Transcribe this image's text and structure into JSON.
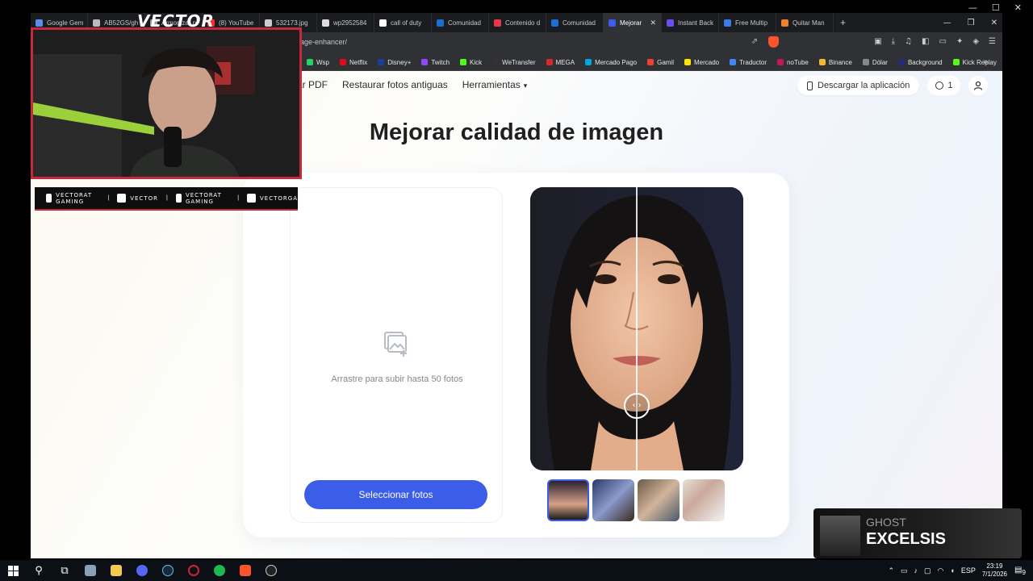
{
  "window": {
    "controls": [
      "—",
      "☐",
      "✕"
    ]
  },
  "tabs": [
    {
      "label": "Google Gem",
      "color": "#5b8def"
    },
    {
      "label": "AB52GS/gh",
      "color": "#bbbbbb"
    },
    {
      "label": "Armonizar p",
      "color": "#999999"
    },
    {
      "label": "(8) YouTube",
      "color": "#ff2a2a"
    },
    {
      "label": "532173.jpg",
      "color": "#cccccc"
    },
    {
      "label": "wp2952584",
      "color": "#dddddd"
    },
    {
      "label": "call of duty",
      "color": "#ffffff"
    },
    {
      "label": "Comunidad",
      "color": "#1b6fd1"
    },
    {
      "label": "Contenido d",
      "color": "#e8374b"
    },
    {
      "label": "Comunidad",
      "color": "#1b6fd1"
    },
    {
      "label": "Mejorar",
      "color": "#3b5de8",
      "active": true
    },
    {
      "label": "Instant Back",
      "color": "#6c4df5"
    },
    {
      "label": "Free Multip",
      "color": "#3b7ce8"
    },
    {
      "label": "Quitar Man",
      "color": "#f0812b"
    }
  ],
  "tab_new": "+",
  "address": {
    "url": "age-enhancer/"
  },
  "bookmarks": [
    {
      "label": "Wsp",
      "color": "#25d366"
    },
    {
      "label": "Netflix",
      "color": "#e50914"
    },
    {
      "label": "Disney+",
      "color": "#1a3f9a"
    },
    {
      "label": "Twitch",
      "color": "#9146ff"
    },
    {
      "label": "Kick",
      "color": "#53fc18"
    },
    {
      "label": "WeTransfer",
      "color": "#333333"
    },
    {
      "label": "MEGA",
      "color": "#d9272e"
    },
    {
      "label": "Mercado Pago",
      "color": "#00a6e0"
    },
    {
      "label": "Gamil",
      "color": "#ea4335"
    },
    {
      "label": "Mercado",
      "color": "#ffe600"
    },
    {
      "label": "Traductor",
      "color": "#4285f4"
    },
    {
      "label": "noTube",
      "color": "#c2185b"
    },
    {
      "label": "Binance",
      "color": "#f3ba2f"
    },
    {
      "label": "Dólar",
      "color": "#888888"
    },
    {
      "label": "Background",
      "color": "#2a2a7a"
    },
    {
      "label": "Kick Replay",
      "color": "#53fc18"
    }
  ],
  "bookmarks_more": "»",
  "site": {
    "nav": [
      {
        "label": "ar PDF"
      },
      {
        "label": "Restaurar fotos antiguas"
      },
      {
        "label": "Herramientas"
      }
    ],
    "download_app": "Descargar la aplicación",
    "credits": "1",
    "title": "Mejorar calidad de imagen",
    "drop_text": "Arrastre para subir hasta 50 fotos",
    "select_button": "Seleccionar fotos",
    "accent": "#3b5de8"
  },
  "overlay": {
    "streamer": "VECTOR",
    "socials": [
      {
        "label": "VECTORAT GAMING",
        "icon": "youtube-icon"
      },
      {
        "label": "VECTOR",
        "icon": "twitch-icon"
      },
      {
        "label": "VECTORAT GAMING",
        "icon": "twitter-icon"
      },
      {
        "label": "VECTORGA",
        "icon": "instagram-icon"
      }
    ],
    "accent": "#c42a3a"
  },
  "now_playing": {
    "artist": "GHOST",
    "title": "EXCELSIS"
  },
  "taskbar": {
    "lang": "ESP",
    "time": "23:19",
    "date": "7/1/2026",
    "notifications": "9"
  }
}
